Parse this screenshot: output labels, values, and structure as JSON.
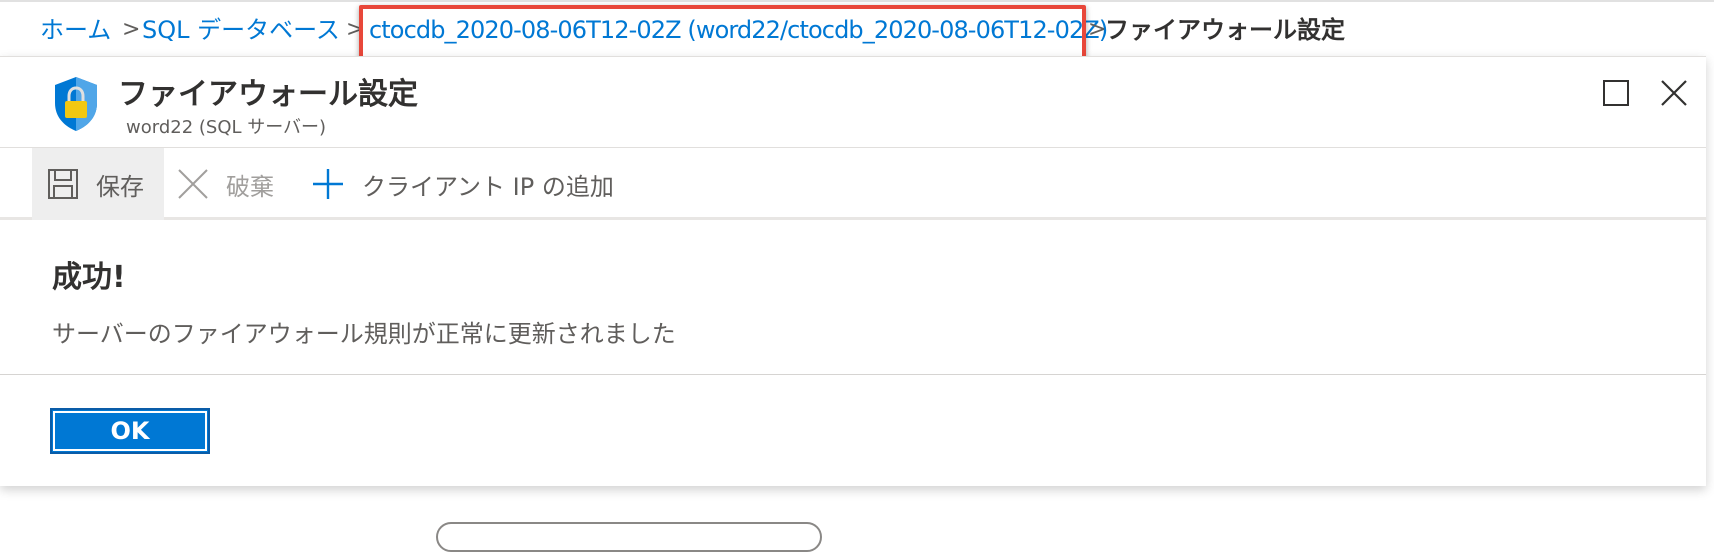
{
  "breadcrumb": {
    "home": "ホーム",
    "sql_db": "SQL データベース",
    "database": "ctocdb_2020-08-06T12-02Z (word22/ctocdb_2020-08-06T12-02Z)",
    "current": "ファイアウォール設定",
    "separator": ">"
  },
  "blade": {
    "title": "ファイアウォール設定",
    "subtitle": "word22 (SQL サーバー)",
    "shield_icon": "shield-lock-icon",
    "colors": {
      "shield": "#0078d4",
      "lock": "#f2c811",
      "highlight": "#e8473a"
    }
  },
  "commands": {
    "save": "保存",
    "discard": "破棄",
    "add_client_ip": "クライアント IP の追加"
  },
  "dialog": {
    "title": "成功!",
    "message": "サーバーのファイアウォール規則が正常に更新されました",
    "ok": "OK"
  }
}
